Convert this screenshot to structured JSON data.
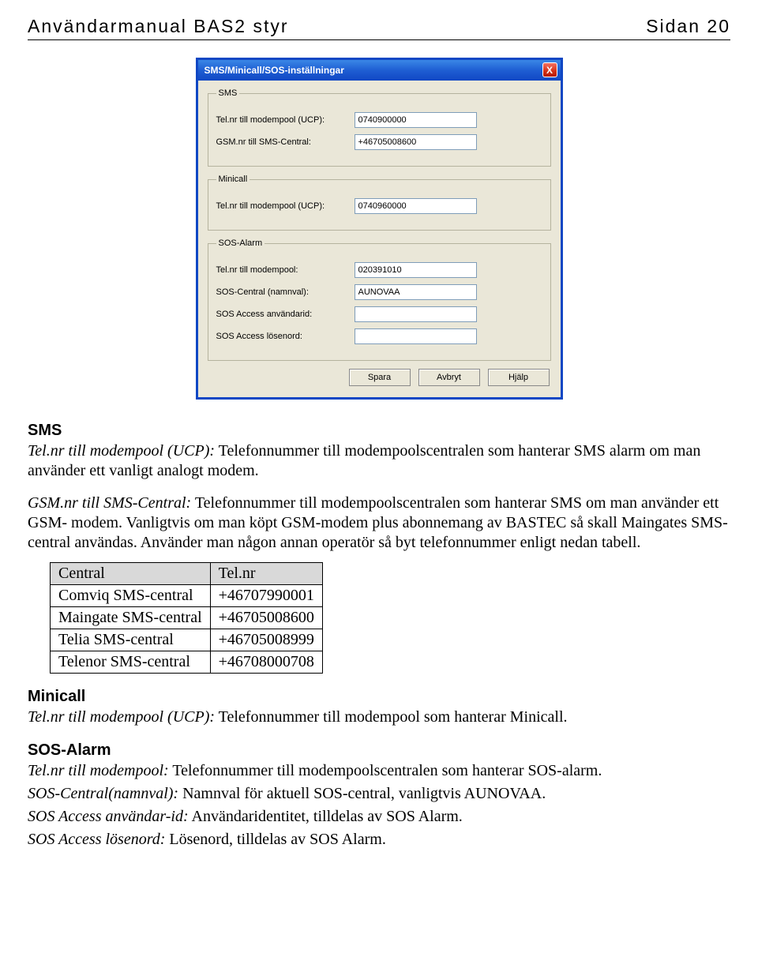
{
  "header": {
    "title": "Användarmanual BAS2 styr",
    "page": "Sidan 20"
  },
  "dialog": {
    "title": "SMS/Minicall/SOS-inställningar",
    "close_icon": "X",
    "groups": {
      "sms": {
        "legend": "SMS",
        "fields": [
          {
            "label": "Tel.nr till modempool (UCP):",
            "value": "0740900000"
          },
          {
            "label": "GSM.nr till SMS-Central:",
            "value": "+46705008600"
          }
        ]
      },
      "minicall": {
        "legend": "Minicall",
        "fields": [
          {
            "label": "Tel.nr till modempool (UCP):",
            "value": "0740960000"
          }
        ]
      },
      "sos": {
        "legend": "SOS-Alarm",
        "fields": [
          {
            "label": "Tel.nr till modempool:",
            "value": "020391010"
          },
          {
            "label": "SOS-Central (namnval):",
            "value": "AUNOVAA"
          },
          {
            "label": "SOS Access användarid:",
            "value": ""
          },
          {
            "label": "SOS Access lösenord:",
            "value": ""
          }
        ]
      }
    },
    "buttons": {
      "save": "Spara",
      "cancel": "Avbryt",
      "help": "Hjälp"
    }
  },
  "sections": {
    "sms": {
      "heading": "SMS",
      "p1_i": "Tel.nr till modempool (UCP):",
      "p1": " Telefonnummer till modempoolscentralen som hanterar SMS alarm om man använder ett vanligt analogt modem.",
      "p2_i": "GSM.nr till SMS-Central:",
      "p2": " Telefonnummer till modempoolscentralen som hanterar SMS om man använder ett GSM- modem. Vanligtvis om man köpt GSM-modem plus abonnemang av BASTEC så skall Maingates SMS-central användas. Använder man någon annan operatör så byt telefonnummer enligt nedan tabell."
    },
    "table": {
      "headers": [
        "Central",
        "Tel.nr"
      ],
      "rows": [
        [
          "Comviq SMS-central",
          "+46707990001"
        ],
        [
          "Maingate SMS-central",
          "+46705008600"
        ],
        [
          "Telia SMS-central",
          "+46705008999"
        ],
        [
          "Telenor SMS-central",
          "+46708000708"
        ]
      ]
    },
    "minicall": {
      "heading": "Minicall",
      "p1_i": "Tel.nr till modempool (UCP):",
      "p1": " Telefonnummer till modempool som hanterar Minicall."
    },
    "sos": {
      "heading": "SOS-Alarm",
      "lines": [
        {
          "i": "Tel.nr till modempool:",
          "t": " Telefonnummer till modempoolscentralen som hanterar SOS-alarm."
        },
        {
          "i": "SOS-Central(namnval):",
          "t": " Namnval för aktuell SOS-central, vanligtvis AUNOVAA."
        },
        {
          "i": "SOS Access användar-id:",
          "t": " Användaridentitet, tilldelas av SOS Alarm."
        },
        {
          "i": "SOS Access lösenord:",
          "t": " Lösenord, tilldelas av SOS Alarm."
        }
      ]
    }
  }
}
